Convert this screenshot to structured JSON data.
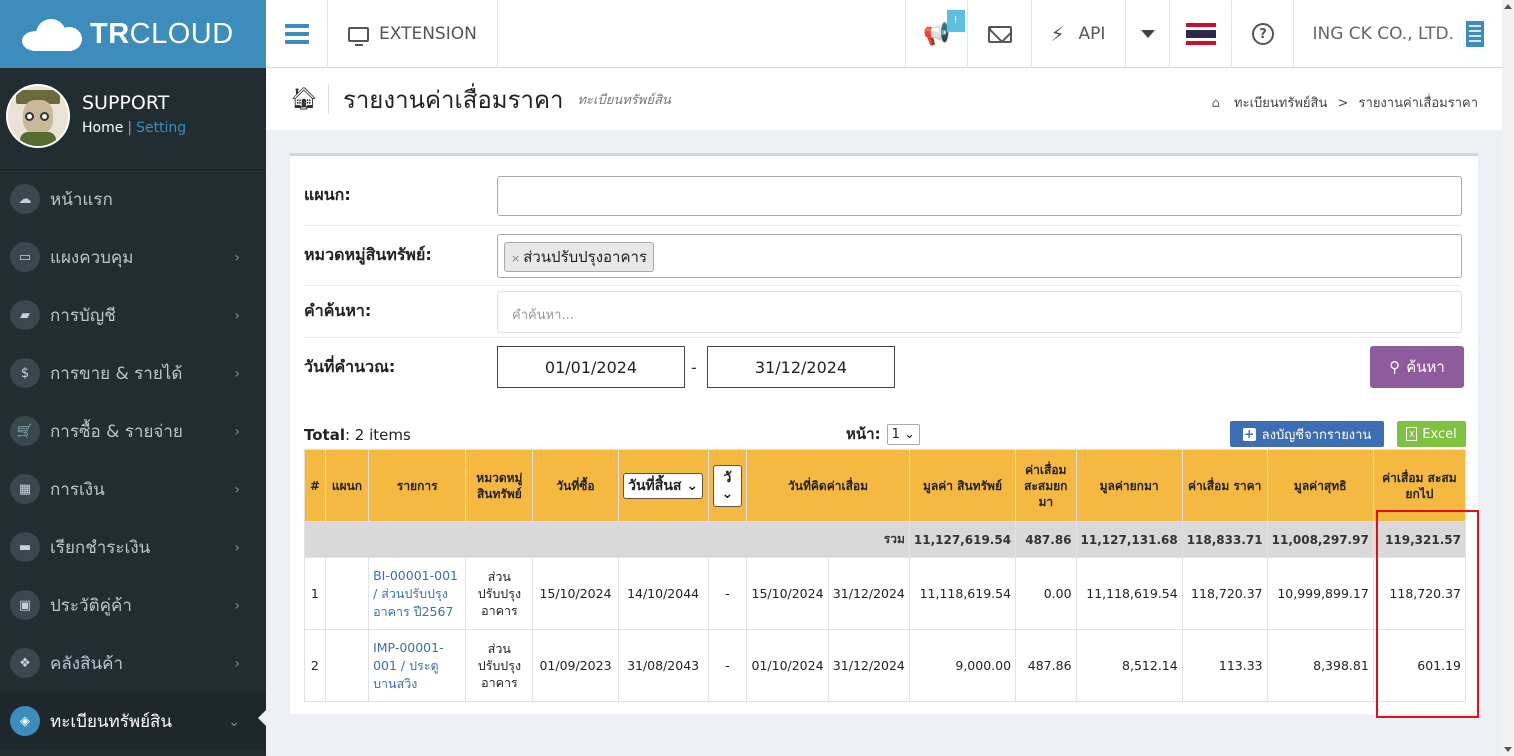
{
  "app": {
    "brand_bold": "TR",
    "brand_rest": "CLOUD"
  },
  "user": {
    "name": "SUPPORT",
    "home_link": "Home",
    "separator": "|",
    "setting_link": "Setting"
  },
  "sidebar": {
    "items": [
      {
        "label": "หน้าแรก",
        "icon": "cloud-icon",
        "glyph": "☁",
        "has_submenu": false
      },
      {
        "label": "แผงควบคุม",
        "icon": "monitor-icon",
        "glyph": "▭",
        "has_submenu": true
      },
      {
        "label": "การบัญชี",
        "icon": "book-icon",
        "glyph": "▰",
        "has_submenu": true
      },
      {
        "label": "การขาย & รายได้",
        "icon": "dollar-icon",
        "glyph": "$",
        "has_submenu": true
      },
      {
        "label": "การซื้อ & รายจ่าย",
        "icon": "cart-icon",
        "glyph": "🛒",
        "has_submenu": true
      },
      {
        "label": "การเงิน",
        "icon": "calendar-icon",
        "glyph": "▦",
        "has_submenu": true
      },
      {
        "label": "เรียกชำระเงิน",
        "icon": "credit-card-icon",
        "glyph": "▬",
        "has_submenu": true
      },
      {
        "label": "ประวัติคู่ค้า",
        "icon": "address-book-icon",
        "glyph": "▣",
        "has_submenu": true
      },
      {
        "label": "คลังสินค้า",
        "icon": "cubes-icon",
        "glyph": "❖",
        "has_submenu": true
      },
      {
        "label": "ทะเบียนทรัพย์สิน",
        "icon": "diamond-icon",
        "glyph": "◈",
        "has_submenu": true,
        "active": true
      }
    ]
  },
  "navbar": {
    "extension_label": "EXTENSION",
    "notification_badge": "!",
    "api_label": "API",
    "company_name": "ING CK CO., LTD."
  },
  "header": {
    "title": "รายงานค่าเสื่อมราคา",
    "subtitle": "ทะเบียนทรัพย์สิน",
    "breadcrumb": {
      "parent": "ทะเบียนทรัพย์สิน",
      "separator": ">",
      "current": "รายงานค่าเสื่อมราคา"
    }
  },
  "filters": {
    "department_label": "แผนก:",
    "department_value": "",
    "category_label": "หมวดหมู่สินทรัพย์:",
    "category_tag": "ส่วนปรับปรุงอาคาร",
    "search_label": "คำค้นหา:",
    "search_placeholder": "คำค้นหา...",
    "date_label": "วันที่คำนวณ:",
    "date_from": "01/01/2024",
    "date_separator": "-",
    "date_to": "31/12/2024",
    "search_button": "ค้นหา"
  },
  "list": {
    "total_label": "Total",
    "total_value": ": 2 items",
    "page_label": "หน้า:",
    "page_value": "1",
    "post_button": "ลงบัญชีจากรายงาน",
    "excel_button": "Excel"
  },
  "table": {
    "headers": {
      "num": "#",
      "department": "แผนก",
      "item": "รายการ",
      "category": "หมวดหมู่ สินทรัพย์",
      "purchase_date": "วันที่ซื้อ",
      "end_date": "วันที่สิ้นส",
      "day": "วั",
      "depr_date": "วันที่คิดค่าเสื่อม",
      "asset_value": "มูลค่า สินทรัพย์",
      "accum_bf": "ค่าเสื่อม สะสมยก มา",
      "value_bf": "มูลค่ายกมา",
      "depreciation": "ค่าเสื่อม ราคา",
      "net_value": "มูลค่าสุทธิ",
      "accum_cf": "ค่าเสื่อม สะสมยกไป"
    },
    "summary": {
      "label": "รวม",
      "asset_value": "11,127,619.54",
      "accum_bf": "487.86",
      "value_bf": "11,127,131.68",
      "depreciation": "118,833.71",
      "net_value": "11,008,297.97",
      "accum_cf": "119,321.57"
    },
    "rows": [
      {
        "num": "1",
        "department": "",
        "item": "BI-00001-001 / ส่วนปรับปรุงอาคาร ปี2567",
        "category": "ส่วน ปรับปรุง อาคาร",
        "purchase_date": "15/10/2024",
        "end_date": "14/10/2044",
        "day": "-",
        "depr_from": "15/10/2024",
        "depr_to": "31/12/2024",
        "asset_value": "11,118,619.54",
        "accum_bf": "0.00",
        "value_bf": "11,118,619.54",
        "depreciation": "118,720.37",
        "net_value": "10,999,899.17",
        "accum_cf": "118,720.37"
      },
      {
        "num": "2",
        "department": "",
        "item": "IMP-00001-001 / ประตูบานสวิง",
        "category": "ส่วน ปรับปรุง อาคาร",
        "purchase_date": "01/09/2023",
        "end_date": "31/08/2043",
        "day": "-",
        "depr_from": "01/10/2024",
        "depr_to": "31/12/2024",
        "asset_value": "9,000.00",
        "accum_bf": "487.86",
        "value_bf": "8,512.14",
        "depreciation": "113.33",
        "net_value": "8,398.81",
        "accum_cf": "601.19"
      }
    ]
  },
  "colors": {
    "sidebar_bg": "#222d32",
    "brand_blue": "#3c8dbc",
    "table_header": "#f5b942",
    "search_button": "#8e5c9c",
    "excel_button": "#7fc241",
    "post_button": "#3c6eb4",
    "highlight": "#e0101a"
  }
}
